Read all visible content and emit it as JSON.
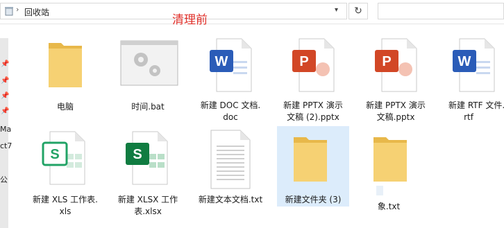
{
  "address": {
    "location": "回收站",
    "separator": "›",
    "chevron": "›",
    "dropdown": "▾"
  },
  "refresh_icon": "↻",
  "annotation": "清理前",
  "sidebar": {
    "items": [
      "Ma",
      "ct7",
      "公"
    ]
  },
  "files": [
    {
      "line1": "电脑",
      "line2": "",
      "icon": "folder-icon"
    },
    {
      "line1": "时间.bat",
      "line2": "",
      "icon": "bat-file-icon"
    },
    {
      "line1": "新建 DOC 文档.",
      "line2": "doc",
      "icon": "word-icon",
      "letter": "W"
    },
    {
      "line1": "新建 PPTX 演示",
      "line2": "文稿 (2).pptx",
      "icon": "powerpoint-icon",
      "letter": "P"
    },
    {
      "line1": "新建 PPTX 演示",
      "line2": "文稿.pptx",
      "icon": "powerpoint-icon",
      "letter": "P"
    },
    {
      "line1": "新建 RTF 文件.",
      "line2": "rtf",
      "icon": "word-icon",
      "letter": "W"
    },
    {
      "line1": "新建 XLS 工作表.",
      "line2": "xls",
      "icon": "excel-icon",
      "letter": "S"
    },
    {
      "line1": "新建 XLSX 工作",
      "line2": "表.xlsx",
      "icon": "excel-icon",
      "letter": "S"
    },
    {
      "line1": "新建文本文档.txt",
      "line2": "",
      "icon": "text-file-icon"
    },
    {
      "line1": "新建文件夹 (3)",
      "line2": "",
      "icon": "folder-icon"
    },
    {
      "line1": "象.txt",
      "line2": "",
      "icon": "folder-icon"
    }
  ],
  "colors": {
    "annotation": "#e0302a",
    "word": "#2b5cb8",
    "powerpoint": "#d24726",
    "excel_dark": "#107c41",
    "excel_light": "#21a366",
    "folder": "#f4cc62",
    "selection": "#dcecfb"
  }
}
